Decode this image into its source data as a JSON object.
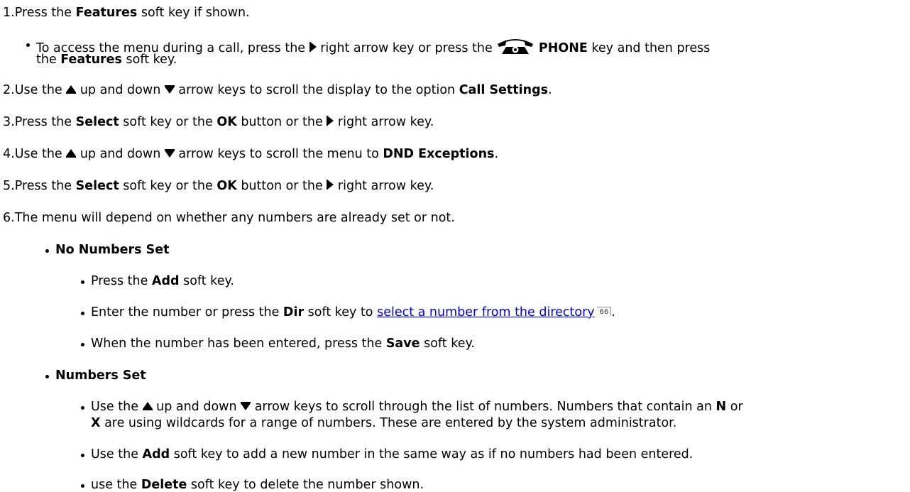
{
  "steps": [
    {
      "num": "1.",
      "a": "Press the ",
      "b1": "Features",
      "c": " soft key if shown."
    },
    {
      "num": "2.",
      "a": "Use the ",
      "b": " up and down ",
      "c": " arrow keys to scroll the display to the option ",
      "b1": "Call Settings",
      "d": "."
    },
    {
      "num": "3.",
      "a": "Press the ",
      "b1": "Select",
      "c": " soft key or the ",
      "b2": "OK",
      "d": " button or the ",
      "e": " right arrow key."
    },
    {
      "num": "4.",
      "a": "Use the ",
      "b": " up and down ",
      "c": " arrow keys to scroll the menu to ",
      "b1": "DND Exceptions",
      "d": "."
    },
    {
      "num": "5.",
      "a": "Press the ",
      "b1": "Select",
      "c": " soft key or the ",
      "b2": "OK",
      "d": " button or the ",
      "e": " right arrow key."
    },
    {
      "num": "6.",
      "a": "The menu will depend on whether any numbers are already set or not."
    }
  ],
  "call_note": {
    "line1_a": "To access the menu during a call, press the ",
    "line1_b": " right arrow key or press the ",
    "line1_phone": "PHONE",
    "line1_c": " key and then press",
    "line2_a": "the ",
    "line2_bold": "Features",
    "line2_c": " soft key."
  },
  "no_numbers": {
    "heading": "No Numbers Set",
    "items": [
      {
        "a": "Press the ",
        "b": "Add",
        "c": " soft key."
      },
      {
        "a": "Enter the number or press the ",
        "b": "Dir",
        "c": " soft key to ",
        "link": "select a number from the directory",
        "ref": "66",
        "d": "."
      },
      {
        "a": "When the number has been entered, press the ",
        "b": "Save",
        "c": " soft key."
      }
    ]
  },
  "numbers_set": {
    "heading": "Numbers Set",
    "item1_line1_a": "Use the ",
    "item1_line1_b": " up and down ",
    "item1_line1_c": " arrow keys to scroll through the list of numbers. Numbers that contain an ",
    "item1_line1_n": "N",
    "item1_line1_d": " or",
    "item1_line2_x": "X",
    "item1_line2_a": " are using wildcards for a range of numbers. These are entered by the system administrator.",
    "item2_a": "Use the ",
    "item2_b": "Add",
    "item2_c": " soft key to add a new number in the same way as if no numbers had been entered.",
    "item3_a": "use the ",
    "item3_b": "Delete",
    "item3_c": " soft key to delete the number shown."
  },
  "icons": {
    "right_arrow": "right-arrow-icon",
    "up_arrow": "up-arrow-icon",
    "down_arrow": "down-arrow-icon",
    "phone": "phone-icon"
  }
}
